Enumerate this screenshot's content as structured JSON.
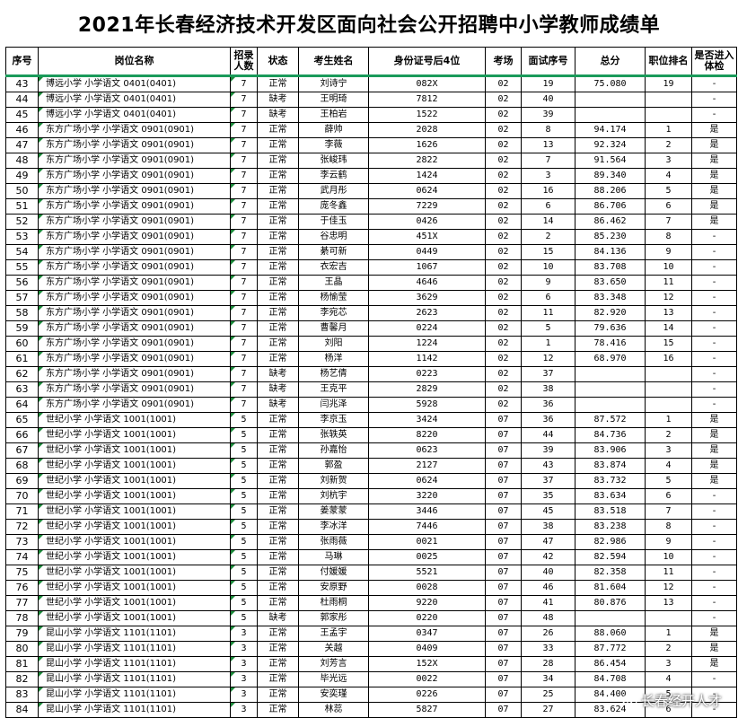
{
  "title": "2021年长春经济技术开发区面向社会公开招聘中小学教师成绩单",
  "headers": [
    "序号",
    "岗位名称",
    "招录人数",
    "状态",
    "考生姓名",
    "身份证号后4位",
    "考场",
    "面试序号",
    "总分",
    "职位排名",
    "是否进入体检"
  ],
  "rows": [
    [
      "43",
      "博远小学 小学语文 0401(0401)",
      "7",
      "正常",
      "刘诗宁",
      "082X",
      "02",
      "19",
      "75.080",
      "19",
      "-"
    ],
    [
      "44",
      "博远小学 小学语文 0401(0401)",
      "7",
      "缺考",
      "王明琦",
      "7812",
      "02",
      "40",
      "",
      "",
      "-"
    ],
    [
      "45",
      "博远小学 小学语文 0401(0401)",
      "7",
      "缺考",
      "王柏岩",
      "1522",
      "02",
      "39",
      "",
      "",
      "-"
    ],
    [
      "46",
      "东方广场小学 小学语文 0901(0901)",
      "7",
      "正常",
      "薛帅",
      "2028",
      "02",
      "8",
      "94.174",
      "1",
      "是"
    ],
    [
      "47",
      "东方广场小学 小学语文 0901(0901)",
      "7",
      "正常",
      "李薇",
      "1626",
      "02",
      "13",
      "92.324",
      "2",
      "是"
    ],
    [
      "48",
      "东方广场小学 小学语文 0901(0901)",
      "7",
      "正常",
      "张峻玮",
      "2822",
      "02",
      "7",
      "91.564",
      "3",
      "是"
    ],
    [
      "49",
      "东方广场小学 小学语文 0901(0901)",
      "7",
      "正常",
      "李云鹤",
      "1424",
      "02",
      "3",
      "89.340",
      "4",
      "是"
    ],
    [
      "50",
      "东方广场小学 小学语文 0901(0901)",
      "7",
      "正常",
      "武月彤",
      "0624",
      "02",
      "16",
      "88.206",
      "5",
      "是"
    ],
    [
      "51",
      "东方广场小学 小学语文 0901(0901)",
      "7",
      "正常",
      "庞冬鑫",
      "7229",
      "02",
      "6",
      "86.706",
      "6",
      "是"
    ],
    [
      "52",
      "东方广场小学 小学语文 0901(0901)",
      "7",
      "正常",
      "于佳玉",
      "0426",
      "02",
      "14",
      "86.462",
      "7",
      "是"
    ],
    [
      "53",
      "东方广场小学 小学语文 0901(0901)",
      "7",
      "正常",
      "谷忠明",
      "451X",
      "02",
      "2",
      "85.230",
      "8",
      "-"
    ],
    [
      "54",
      "东方广场小学 小学语文 0901(0901)",
      "7",
      "正常",
      "綦可新",
      "0449",
      "02",
      "15",
      "84.136",
      "9",
      "-"
    ],
    [
      "55",
      "东方广场小学 小学语文 0901(0901)",
      "7",
      "正常",
      "衣宏吉",
      "1067",
      "02",
      "10",
      "83.708",
      "10",
      "-"
    ],
    [
      "56",
      "东方广场小学 小学语文 0901(0901)",
      "7",
      "正常",
      "王晶",
      "4646",
      "02",
      "9",
      "83.650",
      "11",
      "-"
    ],
    [
      "57",
      "东方广场小学 小学语文 0901(0901)",
      "7",
      "正常",
      "杨愉莹",
      "3629",
      "02",
      "6",
      "83.348",
      "12",
      "-"
    ],
    [
      "58",
      "东方广场小学 小学语文 0901(0901)",
      "7",
      "正常",
      "李宛芯",
      "2623",
      "02",
      "11",
      "82.920",
      "13",
      "-"
    ],
    [
      "59",
      "东方广场小学 小学语文 0901(0901)",
      "7",
      "正常",
      "曹馨月",
      "0224",
      "02",
      "5",
      "79.636",
      "14",
      "-"
    ],
    [
      "60",
      "东方广场小学 小学语文 0901(0901)",
      "7",
      "正常",
      "刘阳",
      "1224",
      "02",
      "1",
      "78.416",
      "15",
      "-"
    ],
    [
      "61",
      "东方广场小学 小学语文 0901(0901)",
      "7",
      "正常",
      "杨洋",
      "1142",
      "02",
      "12",
      "68.970",
      "16",
      "-"
    ],
    [
      "62",
      "东方广场小学 小学语文 0901(0901)",
      "7",
      "缺考",
      "杨艺倩",
      "0223",
      "02",
      "37",
      "",
      "",
      "-"
    ],
    [
      "63",
      "东方广场小学 小学语文 0901(0901)",
      "7",
      "缺考",
      "王克平",
      "2829",
      "02",
      "38",
      "",
      "",
      "-"
    ],
    [
      "64",
      "东方广场小学 小学语文 0901(0901)",
      "7",
      "缺考",
      "闫兆泽",
      "5928",
      "02",
      "36",
      "",
      "",
      "-"
    ],
    [
      "65",
      "世纪小学 小学语文 1001(1001)",
      "5",
      "正常",
      "李京玉",
      "3424",
      "07",
      "36",
      "87.572",
      "1",
      "是"
    ],
    [
      "66",
      "世纪小学 小学语文 1001(1001)",
      "5",
      "正常",
      "张轶英",
      "8220",
      "07",
      "44",
      "84.736",
      "2",
      "是"
    ],
    [
      "67",
      "世纪小学 小学语文 1001(1001)",
      "5",
      "正常",
      "孙嘉怡",
      "0623",
      "07",
      "39",
      "83.906",
      "3",
      "是"
    ],
    [
      "68",
      "世纪小学 小学语文 1001(1001)",
      "5",
      "正常",
      "郭盈",
      "2127",
      "07",
      "43",
      "83.874",
      "4",
      "是"
    ],
    [
      "69",
      "世纪小学 小学语文 1001(1001)",
      "5",
      "正常",
      "刘新贺",
      "0624",
      "07",
      "37",
      "83.732",
      "5",
      "是"
    ],
    [
      "70",
      "世纪小学 小学语文 1001(1001)",
      "5",
      "正常",
      "刘杭宇",
      "3220",
      "07",
      "35",
      "83.634",
      "6",
      "-"
    ],
    [
      "71",
      "世纪小学 小学语文 1001(1001)",
      "5",
      "正常",
      "姜蒙蒙",
      "3446",
      "07",
      "45",
      "83.518",
      "7",
      "-"
    ],
    [
      "72",
      "世纪小学 小学语文 1001(1001)",
      "5",
      "正常",
      "李冰洋",
      "7446",
      "07",
      "38",
      "83.238",
      "8",
      "-"
    ],
    [
      "73",
      "世纪小学 小学语文 1001(1001)",
      "5",
      "正常",
      "张雨薇",
      "0021",
      "07",
      "47",
      "82.986",
      "9",
      "-"
    ],
    [
      "74",
      "世纪小学 小学语文 1001(1001)",
      "5",
      "正常",
      "马琳",
      "0025",
      "07",
      "42",
      "82.594",
      "10",
      "-"
    ],
    [
      "75",
      "世纪小学 小学语文 1001(1001)",
      "5",
      "正常",
      "付媛媛",
      "5521",
      "07",
      "40",
      "82.358",
      "11",
      "-"
    ],
    [
      "76",
      "世纪小学 小学语文 1001(1001)",
      "5",
      "正常",
      "安原野",
      "0028",
      "07",
      "46",
      "81.604",
      "12",
      "-"
    ],
    [
      "77",
      "世纪小学 小学语文 1001(1001)",
      "5",
      "正常",
      "杜雨桐",
      "9220",
      "07",
      "41",
      "80.876",
      "13",
      "-"
    ],
    [
      "78",
      "世纪小学 小学语文 1001(1001)",
      "5",
      "缺考",
      "郭家彤",
      "0220",
      "07",
      "48",
      "",
      "",
      "-"
    ],
    [
      "79",
      "昆山小学 小学语文 1101(1101)",
      "3",
      "正常",
      "王孟宇",
      "0347",
      "07",
      "26",
      "88.060",
      "1",
      "是"
    ],
    [
      "80",
      "昆山小学 小学语文 1101(1101)",
      "3",
      "正常",
      "关越",
      "0409",
      "07",
      "33",
      "87.772",
      "2",
      "是"
    ],
    [
      "81",
      "昆山小学 小学语文 1101(1101)",
      "3",
      "正常",
      "刘芳言",
      "152X",
      "07",
      "28",
      "86.454",
      "3",
      "是"
    ],
    [
      "82",
      "昆山小学 小学语文 1101(1101)",
      "3",
      "正常",
      "毕光远",
      "0022",
      "07",
      "34",
      "84.708",
      "4",
      "-"
    ],
    [
      "83",
      "昆山小学 小学语文 1101(1101)",
      "3",
      "正常",
      "安奕瑾",
      "0226",
      "07",
      "25",
      "84.400",
      "5",
      "-"
    ],
    [
      "84",
      "昆山小学 小学语文 1101(1101)",
      "3",
      "正常",
      "林蕊",
      "5827",
      "07",
      "27",
      "83.624",
      "6",
      "-"
    ]
  ],
  "watermark": {
    "text": "长春经开人才",
    "icon": "wechat-icon"
  },
  "colors": {
    "header_rule": "#1a9a5a",
    "cell_marker": "#1a8a3a"
  }
}
